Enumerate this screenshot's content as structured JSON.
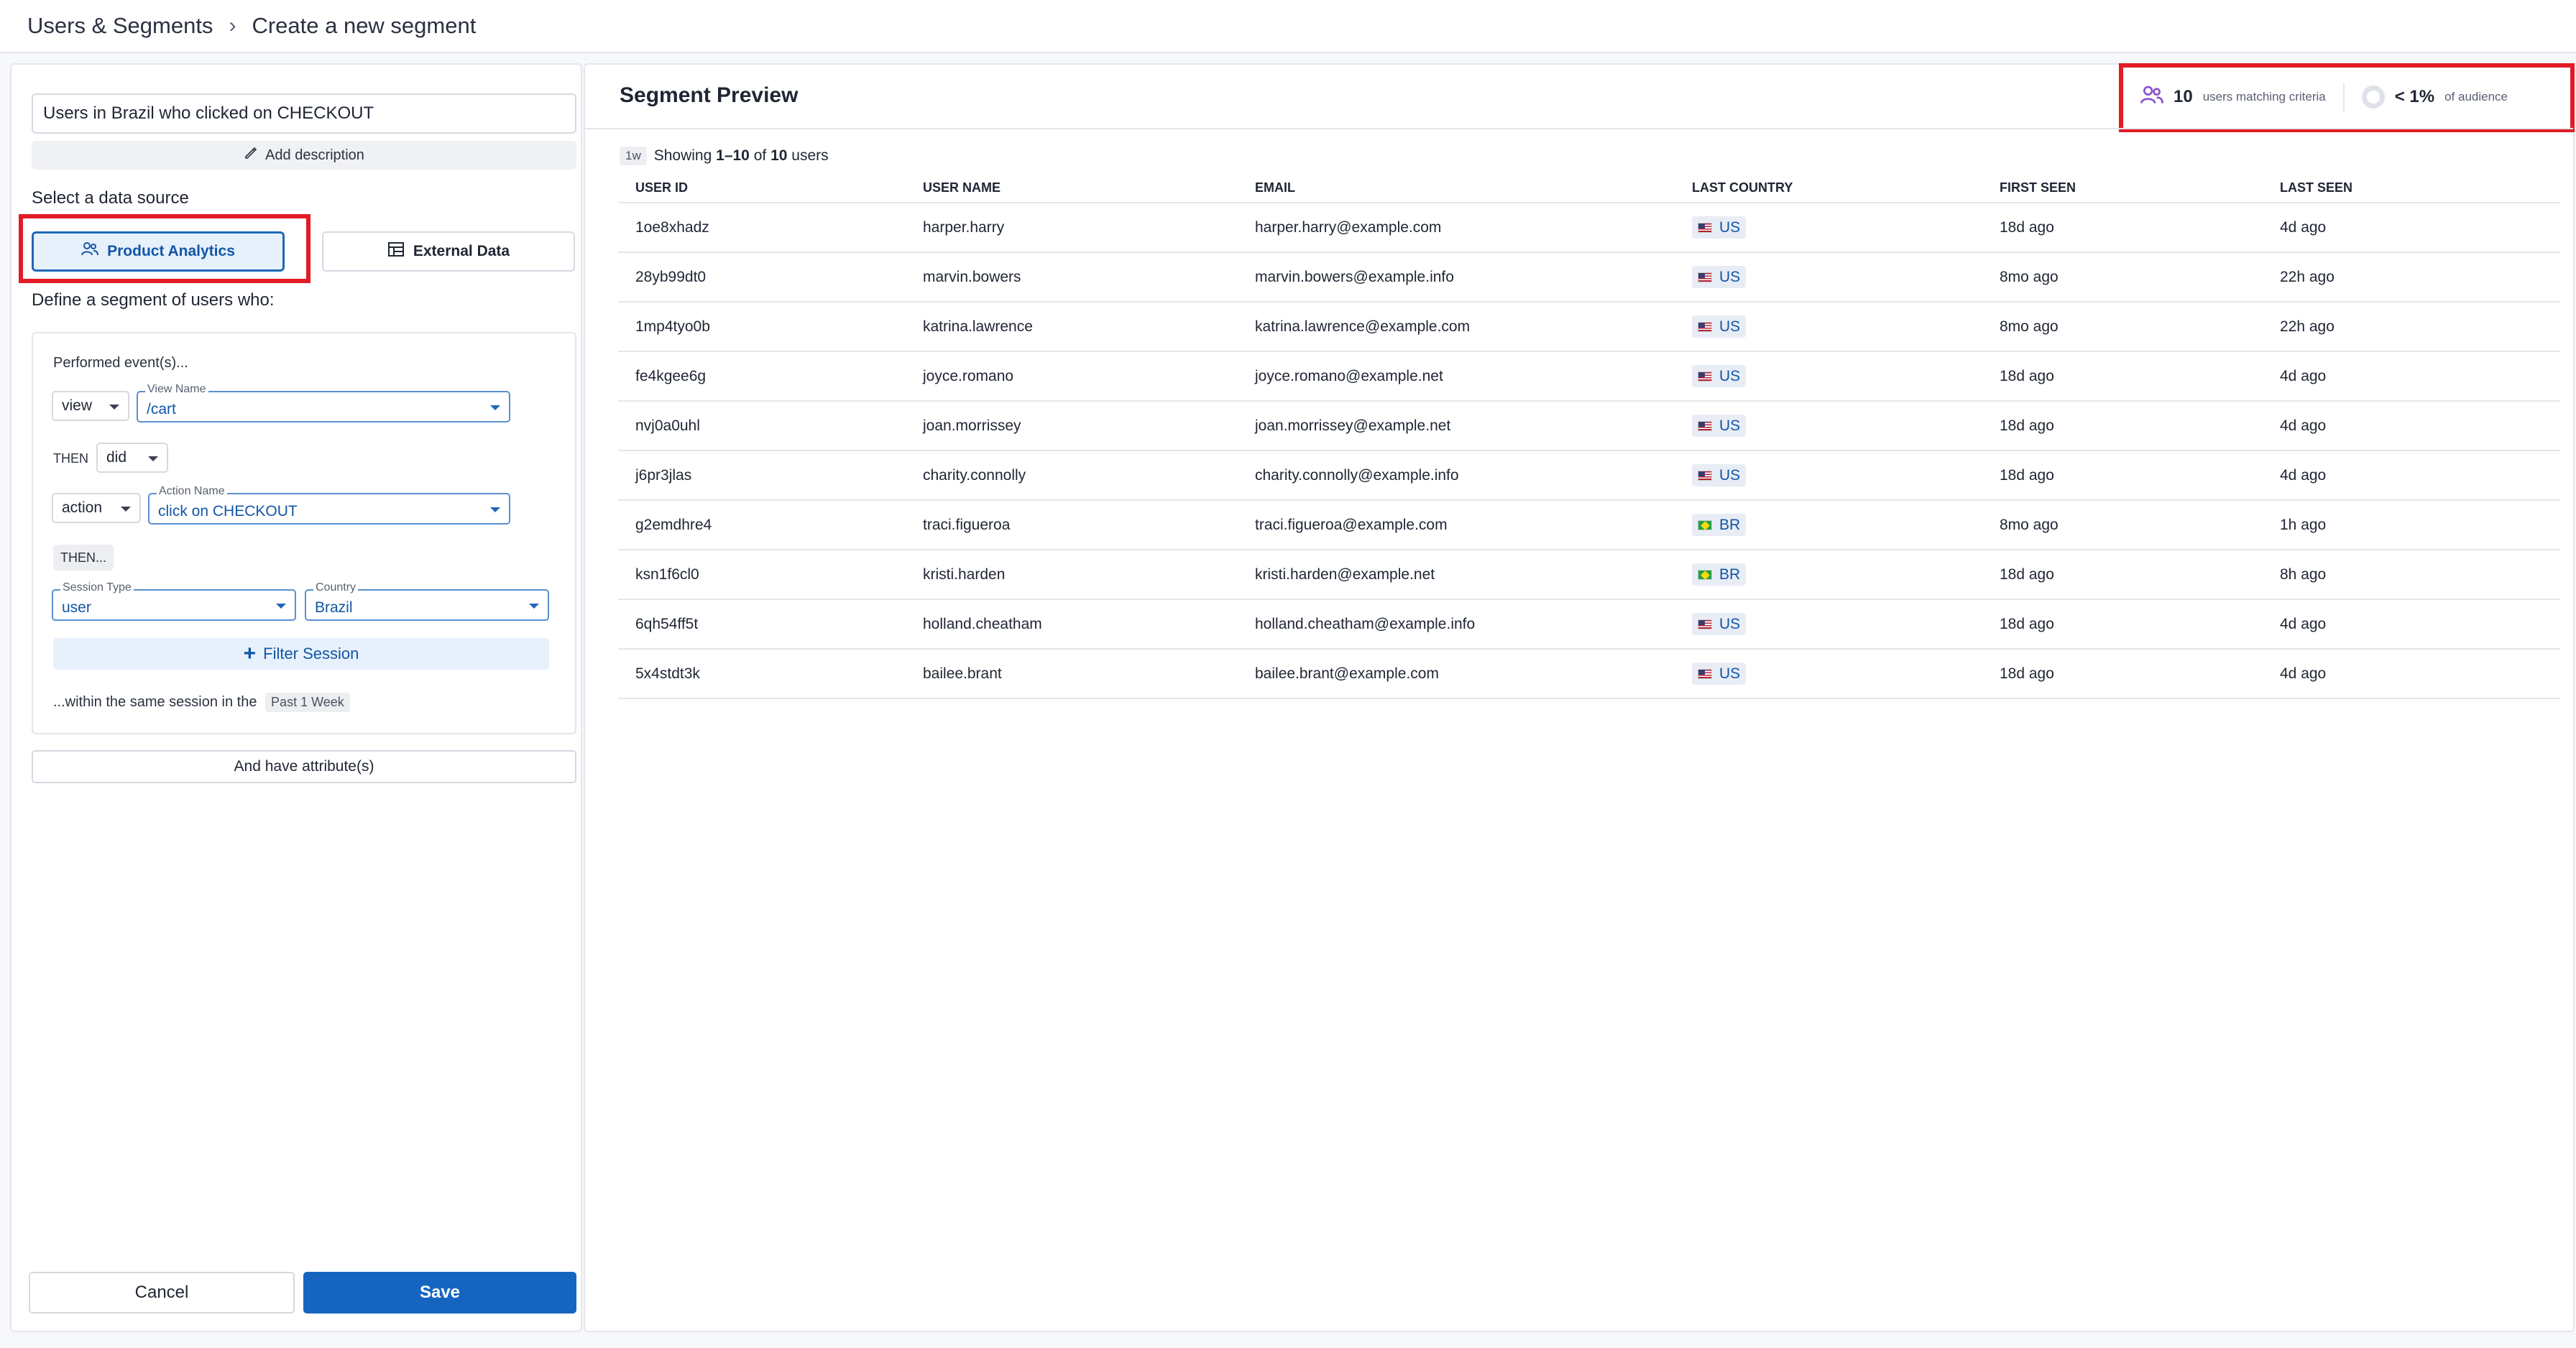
{
  "breadcrumb": {
    "root": "Users & Segments",
    "current": "Create a new segment"
  },
  "segment": {
    "name": "Users in Brazil who clicked on CHECKOUT",
    "add_description": "Add description",
    "data_source_label": "Select a data source",
    "sources": {
      "product_analytics": "Product Analytics",
      "external_data": "External Data"
    },
    "define_label": "Define a segment of users who:"
  },
  "builder": {
    "performed": "Performed event(s)...",
    "step1_type": "view",
    "step1_field_label": "View Name",
    "step1_field_value": "/cart",
    "then_label": "THEN",
    "then_op": "did",
    "step2_type": "action",
    "step2_field_label": "Action Name",
    "step2_field_value": "click on CHECKOUT",
    "then_chip": "THEN...",
    "session_type_label": "Session Type",
    "session_type_value": "user",
    "country_label": "Country",
    "country_value": "Brazil",
    "filter_session": "Filter Session",
    "within_text": "...within the same session in the",
    "within_range": "Past 1 Week"
  },
  "attributes_button": "And have attribute(s)",
  "actions": {
    "cancel": "Cancel",
    "save": "Save"
  },
  "preview": {
    "title": "Segment Preview",
    "matching_count": "10",
    "matching_label": "users matching criteria",
    "audience_pct": "< 1%",
    "audience_label": "of audience",
    "timeframe_chip": "1w",
    "showing_prefix": "Showing",
    "showing_range": "1–10",
    "showing_of": "of",
    "showing_total": "10",
    "showing_suffix": "users"
  },
  "table": {
    "columns": [
      "USER ID",
      "USER NAME",
      "EMAIL",
      "LAST COUNTRY",
      "FIRST SEEN",
      "LAST SEEN"
    ],
    "rows": [
      {
        "id": "1oe8xhadz",
        "name": "harper.harry",
        "email": "harper.harry@example.com",
        "country": "US",
        "first": "18d ago",
        "last": "4d ago"
      },
      {
        "id": "28yb99dt0",
        "name": "marvin.bowers",
        "email": "marvin.bowers@example.info",
        "country": "US",
        "first": "8mo ago",
        "last": "22h ago"
      },
      {
        "id": "1mp4tyo0b",
        "name": "katrina.lawrence",
        "email": "katrina.lawrence@example.com",
        "country": "US",
        "first": "8mo ago",
        "last": "22h ago"
      },
      {
        "id": "fe4kgee6g",
        "name": "joyce.romano",
        "email": "joyce.romano@example.net",
        "country": "US",
        "first": "18d ago",
        "last": "4d ago"
      },
      {
        "id": "nvj0a0uhl",
        "name": "joan.morrissey",
        "email": "joan.morrissey@example.net",
        "country": "US",
        "first": "18d ago",
        "last": "4d ago"
      },
      {
        "id": "j6pr3jlas",
        "name": "charity.connolly",
        "email": "charity.connolly@example.info",
        "country": "US",
        "first": "18d ago",
        "last": "4d ago"
      },
      {
        "id": "g2emdhre4",
        "name": "traci.figueroa",
        "email": "traci.figueroa@example.com",
        "country": "BR",
        "first": "8mo ago",
        "last": "1h ago"
      },
      {
        "id": "ksn1f6cl0",
        "name": "kristi.harden",
        "email": "kristi.harden@example.net",
        "country": "BR",
        "first": "18d ago",
        "last": "8h ago"
      },
      {
        "id": "6qh54ff5t",
        "name": "holland.cheatham",
        "email": "holland.cheatham@example.info",
        "country": "US",
        "first": "18d ago",
        "last": "4d ago"
      },
      {
        "id": "5x4stdt3k",
        "name": "bailee.brant",
        "email": "bailee.brant@example.com",
        "country": "US",
        "first": "18d ago",
        "last": "4d ago"
      }
    ]
  }
}
